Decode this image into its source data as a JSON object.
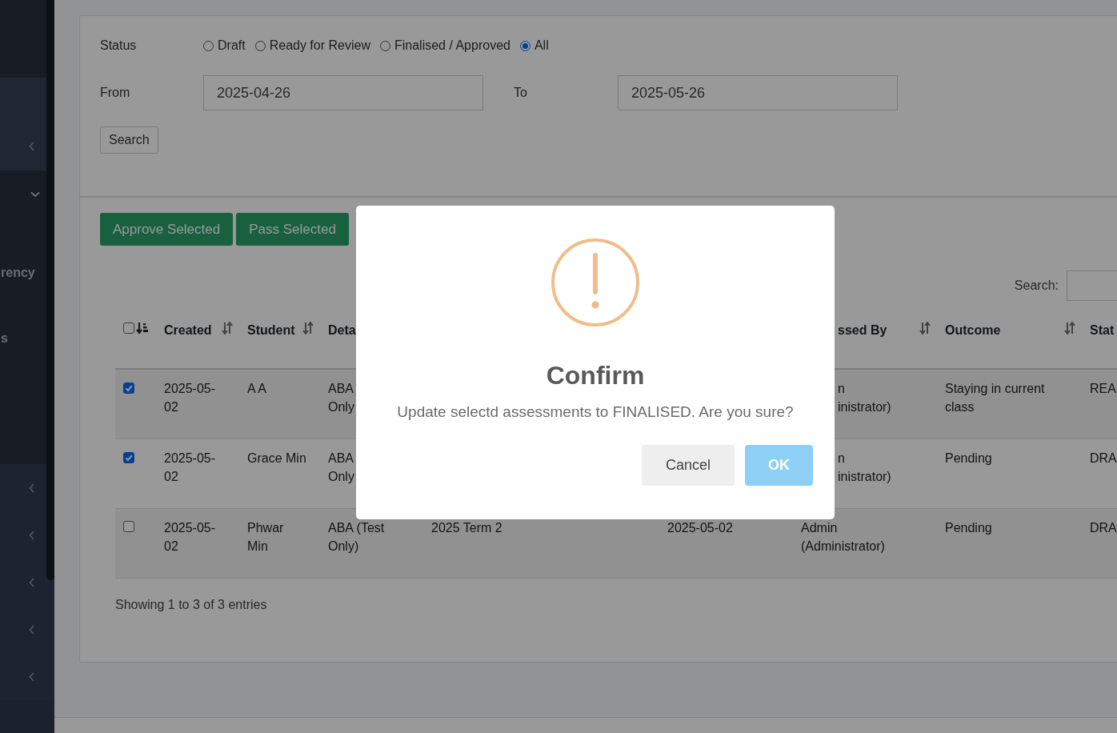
{
  "sidebar": {
    "items": [
      {
        "expanded": false
      },
      {
        "expanded": true,
        "children": [
          {
            "label": "rency"
          },
          {
            "label": "s"
          }
        ]
      },
      {
        "expanded": false
      },
      {
        "expanded": false
      },
      {
        "expanded": false
      },
      {
        "expanded": false
      },
      {
        "expanded": false
      }
    ]
  },
  "filters": {
    "status_label": "Status",
    "status_options": [
      {
        "label": "Draft",
        "selected": false
      },
      {
        "label": "Ready for Review",
        "selected": false
      },
      {
        "label": "Finalised / Approved",
        "selected": false
      },
      {
        "label": "All",
        "selected": true
      }
    ],
    "from_label": "From",
    "from_value": "2025-04-26",
    "to_label": "To",
    "to_value": "2025-05-26",
    "search_button": "Search"
  },
  "actions": [
    "Approve Selected",
    "Pass Selected"
  ],
  "table": {
    "search_label": "Search:",
    "select_all": {
      "checked": false,
      "sorted": true
    },
    "columns": [
      {
        "label": "Created",
        "sorted": false
      },
      {
        "label": "Student",
        "sorted": false
      },
      {
        "label": "Deta"
      },
      {},
      {},
      {
        "label": "ssed By",
        "sorted": false,
        "cut": true
      },
      {
        "label": "Outcome",
        "sorted": false
      },
      {
        "label": "Stat"
      }
    ],
    "rows": [
      {
        "selected": true,
        "cells": [
          {
            "text": "2025-05-02"
          },
          {
            "text": "A A"
          },
          {
            "text": "ABA\nOnly"
          },
          {
            "text": ""
          },
          {
            "text": ""
          },
          {
            "text": "n\ninistrator)",
            "cut": true
          },
          {
            "text": "Staying in current class"
          },
          {
            "text": "REA"
          }
        ]
      },
      {
        "selected": true,
        "cells": [
          {
            "text": "2025-05-02"
          },
          {
            "text": "Grace Min"
          },
          {
            "text": "ABA\nOnly"
          },
          {
            "text": ""
          },
          {
            "text": ""
          },
          {
            "text": "n\ninistrator)",
            "cut": true
          },
          {
            "text": "Pending"
          },
          {
            "text": "DRA"
          }
        ]
      },
      {
        "selected": false,
        "cells": [
          {
            "text": "2025-05-02"
          },
          {
            "text": "Phwar Min"
          },
          {
            "text": "ABA (Test Only)"
          },
          {
            "text": "2025 Term 2"
          },
          {
            "text": "2025-05-02"
          },
          {
            "text": "Admin (Administrator)"
          },
          {
            "text": "Pending"
          },
          {
            "text": "DRA"
          }
        ]
      }
    ],
    "info": "Showing 1 to 3 of 3 entries"
  },
  "dialog": {
    "title": "Confirm",
    "message": "Update selectd assessments to FINALISED. Are you sure?",
    "buttons": [
      {
        "kind": "cancel",
        "label": "Cancel"
      },
      {
        "kind": "confirm",
        "label": "OK"
      }
    ]
  }
}
